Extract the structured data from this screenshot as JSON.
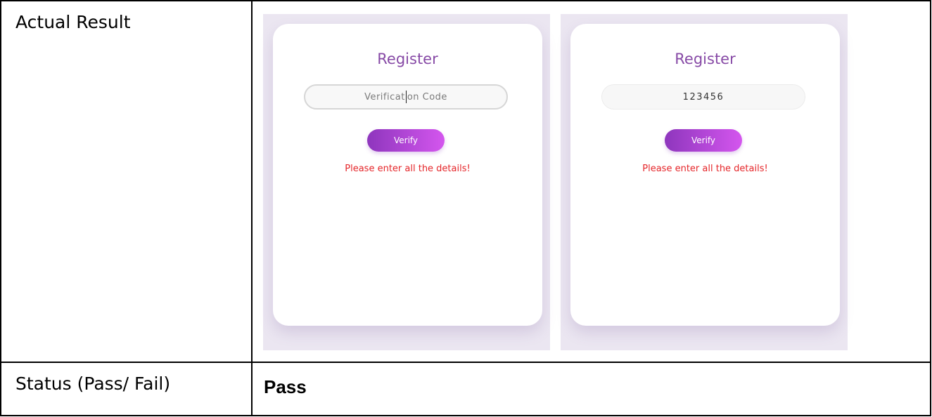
{
  "table": {
    "rows": [
      {
        "label": "Actual Result"
      },
      {
        "label": "Status (Pass/ Fail)",
        "value": "Pass"
      }
    ]
  },
  "screenshots": [
    {
      "title": "Register",
      "input": {
        "placeholder_before_caret": "Verificat",
        "placeholder_after_caret": "on Code",
        "state": "placeholder"
      },
      "button_label": "Verify",
      "error": "Please enter all the details!"
    },
    {
      "title": "Register",
      "input": {
        "value": "123456",
        "state": "filled"
      },
      "button_label": "Verify",
      "error": "Please enter all the details!"
    }
  ],
  "colors": {
    "title": "#874aa6",
    "button_gradient_start": "#8e36bd",
    "button_gradient_end": "#d456ee",
    "error": "#e5262a",
    "screenshot_background": "#ebe6f1"
  }
}
